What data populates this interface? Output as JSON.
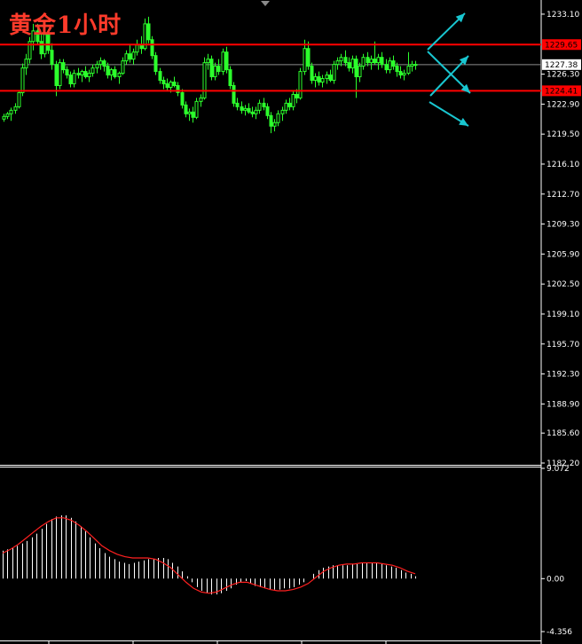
{
  "chart_data": [
    {
      "type": "candlestick",
      "title": "黄金1小时",
      "y_axis": {
        "ticks": [
          "1233.10",
          "1229.65",
          "1227.38",
          "1226.30",
          "1224.41",
          "1222.90",
          "1219.50",
          "1216.10",
          "1212.70",
          "1209.30",
          "1205.90",
          "1202.50",
          "1199.10",
          "1195.70",
          "1192.30",
          "1188.90",
          "1185.60",
          "1182.20"
        ],
        "ylim": [
          1182.2,
          1233.9
        ]
      },
      "current_price": 1227.38,
      "horizontal_lines": [
        {
          "label": "1229.65",
          "value": 1229.65,
          "color": "#ff0000"
        },
        {
          "label": "1224.41",
          "value": 1224.41,
          "color": "#ff0000"
        }
      ],
      "arrows": [
        {
          "direction": "up-right",
          "color": "#19c6d0"
        },
        {
          "direction": "down-right",
          "color": "#19c6d0"
        },
        {
          "direction": "down-right",
          "color": "#19c6d0"
        },
        {
          "direction": "up-right",
          "color": "#19c6d0"
        }
      ],
      "candle_color": "#2cff2c",
      "candles": [
        [
          1221.2,
          1221.8,
          1220.9,
          1221.5
        ],
        [
          1221.5,
          1222.0,
          1221.2,
          1221.8
        ],
        [
          1221.8,
          1222.5,
          1221.0,
          1222.2
        ],
        [
          1222.2,
          1223.0,
          1221.8,
          1222.6
        ],
        [
          1222.6,
          1224.5,
          1222.4,
          1224.2
        ],
        [
          1224.2,
          1227.5,
          1223.8,
          1227.0
        ],
        [
          1227.0,
          1228.6,
          1226.2,
          1228.0
        ],
        [
          1228.0,
          1230.5,
          1227.5,
          1230.0
        ],
        [
          1230.0,
          1232.0,
          1229.0,
          1231.2
        ],
        [
          1231.2,
          1232.0,
          1229.6,
          1230.0
        ],
        [
          1230.0,
          1230.8,
          1228.0,
          1228.6
        ],
        [
          1228.6,
          1231.2,
          1228.2,
          1230.8
        ],
        [
          1230.8,
          1231.4,
          1228.6,
          1229.0
        ],
        [
          1229.0,
          1229.8,
          1226.8,
          1227.4
        ],
        [
          1227.4,
          1227.8,
          1223.8,
          1225.0
        ],
        [
          1225.0,
          1228.0,
          1224.6,
          1227.6
        ],
        [
          1227.6,
          1228.0,
          1226.4,
          1226.8
        ],
        [
          1226.8,
          1227.2,
          1225.8,
          1226.2
        ],
        [
          1226.2,
          1226.6,
          1224.8,
          1225.2
        ],
        [
          1225.2,
          1226.8,
          1224.8,
          1226.4
        ],
        [
          1226.4,
          1227.0,
          1225.8,
          1226.2
        ],
        [
          1226.2,
          1226.8,
          1225.4,
          1226.6
        ],
        [
          1226.6,
          1227.2,
          1225.8,
          1226.0
        ],
        [
          1226.0,
          1226.8,
          1225.4,
          1226.4
        ],
        [
          1226.4,
          1227.4,
          1226.0,
          1227.0
        ],
        [
          1227.0,
          1227.8,
          1226.4,
          1227.4
        ],
        [
          1227.4,
          1228.2,
          1226.8,
          1227.8
        ],
        [
          1227.8,
          1228.0,
          1226.6,
          1227.2
        ],
        [
          1227.2,
          1227.6,
          1225.8,
          1226.2
        ],
        [
          1226.2,
          1227.0,
          1225.6,
          1226.8
        ],
        [
          1226.8,
          1227.2,
          1225.8,
          1226.0
        ],
        [
          1226.0,
          1226.6,
          1225.2,
          1226.4
        ],
        [
          1226.4,
          1228.2,
          1226.2,
          1227.8
        ],
        [
          1227.8,
          1229.0,
          1227.4,
          1228.6
        ],
        [
          1228.6,
          1229.6,
          1227.6,
          1228.0
        ],
        [
          1228.0,
          1229.2,
          1227.4,
          1228.8
        ],
        [
          1228.8,
          1230.2,
          1228.4,
          1229.6
        ],
        [
          1229.6,
          1230.6,
          1228.6,
          1229.2
        ],
        [
          1229.2,
          1232.6,
          1229.0,
          1232.0
        ],
        [
          1232.0,
          1232.8,
          1229.8,
          1230.2
        ],
        [
          1230.2,
          1230.6,
          1228.0,
          1228.4
        ],
        [
          1228.4,
          1228.8,
          1226.2,
          1226.6
        ],
        [
          1226.6,
          1227.0,
          1225.2,
          1225.6
        ],
        [
          1225.6,
          1226.0,
          1224.6,
          1225.2
        ],
        [
          1225.2,
          1225.8,
          1224.4,
          1224.8
        ],
        [
          1224.8,
          1225.6,
          1224.2,
          1225.4
        ],
        [
          1225.4,
          1226.0,
          1224.8,
          1225.0
        ],
        [
          1225.0,
          1225.4,
          1223.8,
          1224.2
        ],
        [
          1224.2,
          1224.6,
          1222.4,
          1222.8
        ],
        [
          1222.8,
          1223.2,
          1221.4,
          1221.8
        ],
        [
          1221.8,
          1222.4,
          1221.0,
          1222.0
        ],
        [
          1222.0,
          1222.6,
          1220.8,
          1221.4
        ],
        [
          1221.4,
          1223.6,
          1221.2,
          1223.2
        ],
        [
          1223.2,
          1224.0,
          1222.6,
          1223.6
        ],
        [
          1223.6,
          1228.2,
          1223.4,
          1227.6
        ],
        [
          1227.6,
          1228.6,
          1226.8,
          1228.0
        ],
        [
          1228.0,
          1228.4,
          1225.6,
          1226.0
        ],
        [
          1226.0,
          1227.6,
          1225.6,
          1227.2
        ],
        [
          1227.2,
          1228.0,
          1226.2,
          1226.6
        ],
        [
          1226.6,
          1229.2,
          1226.2,
          1228.8
        ],
        [
          1228.8,
          1229.4,
          1226.4,
          1226.8
        ],
        [
          1226.8,
          1227.2,
          1224.6,
          1225.0
        ],
        [
          1225.0,
          1225.4,
          1222.6,
          1223.0
        ],
        [
          1223.0,
          1223.6,
          1222.2,
          1222.6
        ],
        [
          1222.6,
          1223.2,
          1221.8,
          1222.2
        ],
        [
          1222.2,
          1222.8,
          1221.6,
          1222.4
        ],
        [
          1222.4,
          1223.0,
          1221.8,
          1222.0
        ],
        [
          1222.0,
          1222.6,
          1221.4,
          1221.8
        ],
        [
          1221.8,
          1222.6,
          1221.2,
          1222.2
        ],
        [
          1222.2,
          1223.4,
          1221.8,
          1223.0
        ],
        [
          1223.0,
          1223.6,
          1222.2,
          1222.6
        ],
        [
          1222.6,
          1223.0,
          1221.2,
          1221.6
        ],
        [
          1221.6,
          1222.0,
          1219.6,
          1220.4
        ],
        [
          1220.4,
          1221.2,
          1219.8,
          1220.8
        ],
        [
          1220.8,
          1222.2,
          1220.4,
          1221.8
        ],
        [
          1221.8,
          1222.6,
          1221.0,
          1222.2
        ],
        [
          1222.2,
          1223.4,
          1221.8,
          1223.0
        ],
        [
          1223.0,
          1223.6,
          1222.2,
          1222.6
        ],
        [
          1222.6,
          1224.4,
          1222.2,
          1224.0
        ],
        [
          1224.0,
          1224.6,
          1223.0,
          1223.6
        ],
        [
          1223.6,
          1227.0,
          1223.4,
          1226.6
        ],
        [
          1226.6,
          1230.2,
          1226.2,
          1229.2
        ],
        [
          1229.2,
          1230.0,
          1226.8,
          1227.2
        ],
        [
          1227.2,
          1227.6,
          1225.2,
          1225.6
        ],
        [
          1225.6,
          1226.4,
          1224.8,
          1226.0
        ],
        [
          1226.0,
          1226.6,
          1225.0,
          1225.4
        ],
        [
          1225.4,
          1226.2,
          1224.8,
          1225.8
        ],
        [
          1225.8,
          1226.6,
          1225.2,
          1226.2
        ],
        [
          1226.2,
          1226.8,
          1225.4,
          1225.6
        ],
        [
          1225.6,
          1227.8,
          1225.2,
          1227.4
        ],
        [
          1227.4,
          1228.2,
          1226.8,
          1227.8
        ],
        [
          1227.8,
          1228.6,
          1227.2,
          1228.2
        ],
        [
          1228.2,
          1229.0,
          1227.2,
          1227.6
        ],
        [
          1227.6,
          1228.2,
          1226.6,
          1227.0
        ],
        [
          1227.0,
          1228.4,
          1226.4,
          1228.0
        ],
        [
          1228.0,
          1228.4,
          1223.6,
          1226.0
        ],
        [
          1226.0,
          1227.6,
          1225.4,
          1227.2
        ],
        [
          1227.2,
          1228.6,
          1226.8,
          1228.2
        ],
        [
          1228.2,
          1228.8,
          1227.2,
          1227.6
        ],
        [
          1227.6,
          1228.4,
          1226.8,
          1228.0
        ],
        [
          1228.0,
          1230.0,
          1227.4,
          1227.6
        ],
        [
          1227.6,
          1228.6,
          1226.8,
          1228.2
        ],
        [
          1228.2,
          1228.8,
          1227.0,
          1227.4
        ],
        [
          1227.4,
          1228.0,
          1226.4,
          1226.8
        ],
        [
          1226.8,
          1228.2,
          1226.4,
          1227.8
        ],
        [
          1227.8,
          1228.4,
          1226.8,
          1227.2
        ],
        [
          1227.2,
          1227.6,
          1226.0,
          1226.6
        ],
        [
          1226.6,
          1227.2,
          1225.8,
          1226.2
        ],
        [
          1226.2,
          1226.8,
          1225.6,
          1226.4
        ],
        [
          1226.4,
          1228.8,
          1226.2,
          1227.2
        ],
        [
          1227.2,
          1227.8,
          1226.6,
          1227.4
        ],
        [
          1227.4,
          1227.8,
          1226.8,
          1227.38
        ]
      ]
    },
    {
      "type": "histogram+line",
      "name": "MACD",
      "y_axis": {
        "ticks": [
          "9.072",
          "0.00",
          "-4.356"
        ],
        "ylim": [
          -4.356,
          9.072
        ]
      },
      "histogram_color": "#ffffff",
      "signal_color": "#ff2020",
      "histogram": [
        2.3,
        2.4,
        2.5,
        2.7,
        2.9,
        3.1,
        3.4,
        3.7,
        4.1,
        4.5,
        4.9,
        5.1,
        5.2,
        5.2,
        5.0,
        4.7,
        4.3,
        3.9,
        3.4,
        2.9,
        2.5,
        2.1,
        1.8,
        1.6,
        1.4,
        1.3,
        1.2,
        1.3,
        1.4,
        1.5,
        1.6,
        1.6,
        1.7,
        1.7,
        1.6,
        1.3,
        1.0,
        0.6,
        0.2,
        -0.3,
        -0.7,
        -1.0,
        -1.2,
        -1.3,
        -1.3,
        -1.2,
        -1.0,
        -0.8,
        -0.5,
        -0.3,
        -0.2,
        -0.4,
        -0.6,
        -0.7,
        -0.8,
        -0.9,
        -0.9,
        -0.9,
        -0.8,
        -0.8,
        -0.7,
        -0.5,
        -0.3,
        0.0,
        0.4,
        0.7,
        0.9,
        1.0,
        1.1,
        1.1,
        1.1,
        1.1,
        1.2,
        1.2,
        1.3,
        1.3,
        1.3,
        1.3,
        1.2,
        1.1,
        1.0,
        0.9,
        0.7,
        0.5,
        0.4,
        0.2
      ],
      "signal": [
        2.1,
        2.4,
        2.8,
        3.3,
        3.8,
        4.3,
        4.7,
        5.0,
        5.0,
        4.8,
        4.4,
        3.9,
        3.3,
        2.7,
        2.3,
        2.0,
        1.8,
        1.7,
        1.7,
        1.7,
        1.6,
        1.3,
        0.9,
        0.3,
        -0.3,
        -0.8,
        -1.1,
        -1.2,
        -1.1,
        -0.8,
        -0.5,
        -0.3,
        -0.3,
        -0.5,
        -0.7,
        -0.9,
        -1.0,
        -1.0,
        -0.9,
        -0.7,
        -0.4,
        0.1,
        0.6,
        0.9,
        1.1,
        1.2,
        1.2,
        1.3,
        1.3,
        1.3,
        1.2,
        1.1,
        0.9,
        0.6,
        0.4
      ]
    }
  ]
}
